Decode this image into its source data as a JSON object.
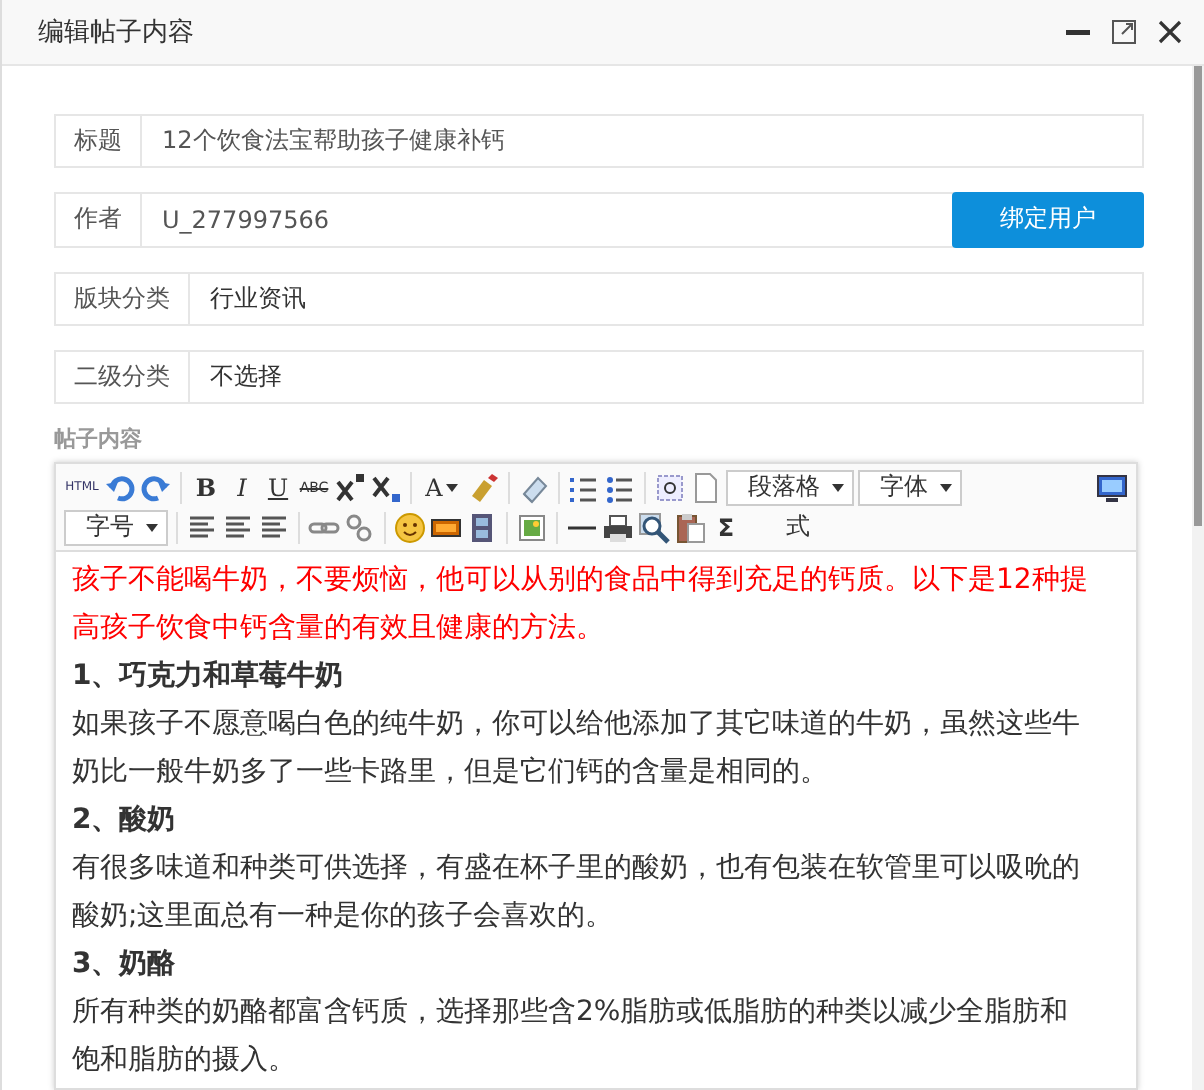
{
  "window": {
    "title": "编辑帖子内容"
  },
  "form": [
    {
      "label": "标题",
      "value": "12个饮食法宝帮助孩子健康补钙"
    },
    {
      "label": "作者",
      "value": "U_277997566",
      "button": "绑定用户"
    },
    {
      "label": "版块分类",
      "value": "行业资讯"
    },
    {
      "label": "二级分类",
      "value": "不选择"
    }
  ],
  "editor": {
    "label": "帖子内容",
    "toolbar": [
      [
        {
          "kind": "html",
          "label": "HTML"
        },
        {
          "kind": "undo"
        },
        {
          "kind": "redo"
        },
        {
          "kind": "sep"
        },
        {
          "kind": "bold",
          "label": "B"
        },
        {
          "kind": "italic",
          "label": "I"
        },
        {
          "kind": "underline",
          "label": "U"
        },
        {
          "kind": "strike",
          "label": "ABC"
        },
        {
          "kind": "superscript"
        },
        {
          "kind": "subscript"
        },
        {
          "kind": "sep"
        },
        {
          "kind": "fontcolor",
          "label": "A"
        },
        {
          "kind": "highlight"
        },
        {
          "kind": "sep"
        },
        {
          "kind": "eraser"
        },
        {
          "kind": "sep"
        },
        {
          "kind": "ol"
        },
        {
          "kind": "ul"
        },
        {
          "kind": "sep"
        },
        {
          "kind": "anchor"
        },
        {
          "kind": "page"
        },
        {
          "kind": "select",
          "label": "段落格"
        },
        {
          "kind": "select",
          "label": "字体"
        },
        {
          "kind": "spacer"
        },
        {
          "kind": "monitor"
        }
      ],
      [
        {
          "kind": "select",
          "label": "字号"
        },
        {
          "kind": "sep"
        },
        {
          "kind": "align"
        },
        {
          "kind": "align"
        },
        {
          "kind": "align"
        },
        {
          "kind": "sep"
        },
        {
          "kind": "link"
        },
        {
          "kind": "unlink"
        },
        {
          "kind": "sep"
        },
        {
          "kind": "emoji"
        },
        {
          "kind": "flash"
        },
        {
          "kind": "video"
        },
        {
          "kind": "sep"
        },
        {
          "kind": "picture"
        },
        {
          "kind": "sep"
        },
        {
          "kind": "hr"
        },
        {
          "kind": "print"
        },
        {
          "kind": "preview"
        },
        {
          "kind": "paste"
        },
        {
          "kind": "sigma",
          "label": "Σ"
        },
        {
          "kind": "plain",
          "label": "式"
        }
      ]
    ],
    "content": [
      {
        "kind": "highlighted",
        "text": "孩子不能喝牛奶，不要烦恼，他可以从别的食品中得到充足的钙质。以下是12种提高孩子饮食中钙含量的有效且健康的方法。"
      },
      {
        "kind": "heading",
        "text": "1、巧克力和草莓牛奶"
      },
      {
        "kind": "paragraph",
        "text": "如果孩子不愿意喝白色的纯牛奶，你可以给他添加了其它味道的牛奶，虽然这些牛奶比一般牛奶多了一些卡路里，但是它们钙的含量是相同的。"
      },
      {
        "kind": "heading",
        "text": "2、酸奶"
      },
      {
        "kind": "paragraph",
        "text": "有很多味道和种类可供选择，有盛在杯子里的酸奶，也有包装在软管里可以吸吮的酸奶;这里面总有一种是你的孩子会喜欢的。"
      },
      {
        "kind": "heading",
        "text": "3、奶酪"
      },
      {
        "kind": "paragraph",
        "text": "所有种类的奶酪都富含钙质，选择那些含2%脂肪或低脂肪的种类以减少全脂肪和饱和脂肪的摄入。"
      }
    ]
  }
}
